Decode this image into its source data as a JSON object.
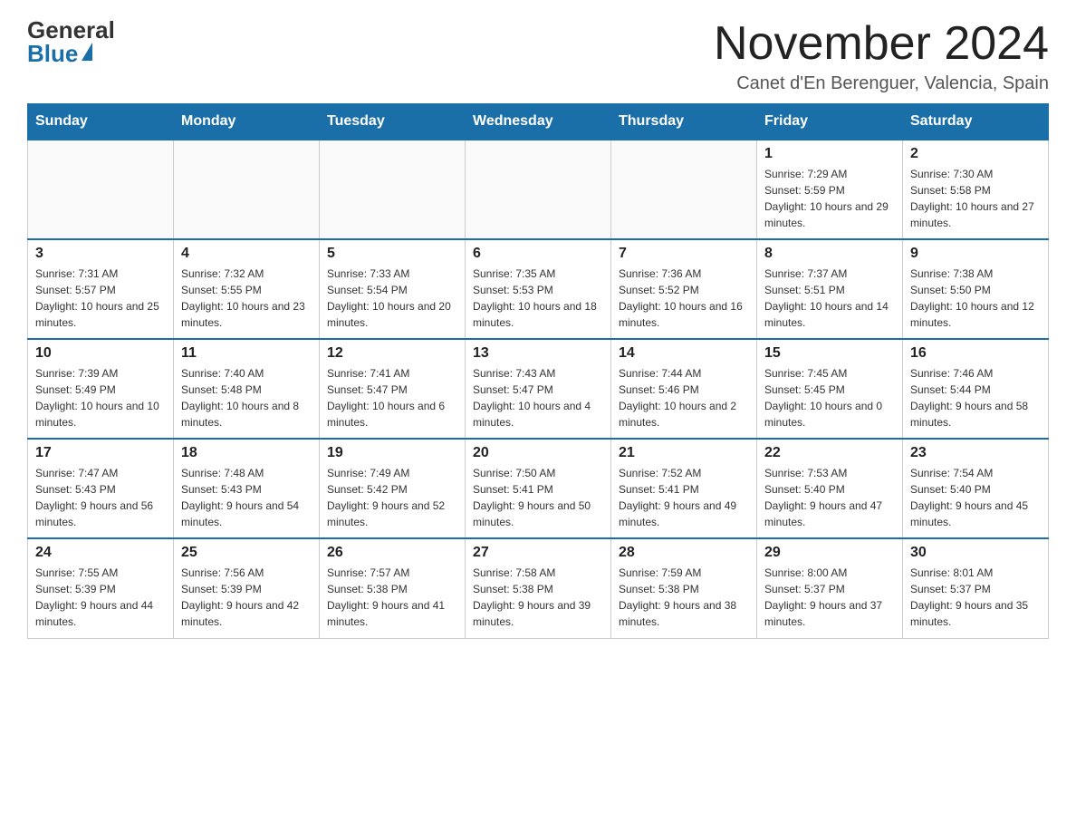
{
  "header": {
    "logo_general": "General",
    "logo_blue": "Blue",
    "month_title": "November 2024",
    "location": "Canet d'En Berenguer, Valencia, Spain"
  },
  "days_of_week": [
    "Sunday",
    "Monday",
    "Tuesday",
    "Wednesday",
    "Thursday",
    "Friday",
    "Saturday"
  ],
  "weeks": [
    [
      {
        "day": "",
        "info": ""
      },
      {
        "day": "",
        "info": ""
      },
      {
        "day": "",
        "info": ""
      },
      {
        "day": "",
        "info": ""
      },
      {
        "day": "",
        "info": ""
      },
      {
        "day": "1",
        "info": "Sunrise: 7:29 AM\nSunset: 5:59 PM\nDaylight: 10 hours and 29 minutes."
      },
      {
        "day": "2",
        "info": "Sunrise: 7:30 AM\nSunset: 5:58 PM\nDaylight: 10 hours and 27 minutes."
      }
    ],
    [
      {
        "day": "3",
        "info": "Sunrise: 7:31 AM\nSunset: 5:57 PM\nDaylight: 10 hours and 25 minutes."
      },
      {
        "day": "4",
        "info": "Sunrise: 7:32 AM\nSunset: 5:55 PM\nDaylight: 10 hours and 23 minutes."
      },
      {
        "day": "5",
        "info": "Sunrise: 7:33 AM\nSunset: 5:54 PM\nDaylight: 10 hours and 20 minutes."
      },
      {
        "day": "6",
        "info": "Sunrise: 7:35 AM\nSunset: 5:53 PM\nDaylight: 10 hours and 18 minutes."
      },
      {
        "day": "7",
        "info": "Sunrise: 7:36 AM\nSunset: 5:52 PM\nDaylight: 10 hours and 16 minutes."
      },
      {
        "day": "8",
        "info": "Sunrise: 7:37 AM\nSunset: 5:51 PM\nDaylight: 10 hours and 14 minutes."
      },
      {
        "day": "9",
        "info": "Sunrise: 7:38 AM\nSunset: 5:50 PM\nDaylight: 10 hours and 12 minutes."
      }
    ],
    [
      {
        "day": "10",
        "info": "Sunrise: 7:39 AM\nSunset: 5:49 PM\nDaylight: 10 hours and 10 minutes."
      },
      {
        "day": "11",
        "info": "Sunrise: 7:40 AM\nSunset: 5:48 PM\nDaylight: 10 hours and 8 minutes."
      },
      {
        "day": "12",
        "info": "Sunrise: 7:41 AM\nSunset: 5:47 PM\nDaylight: 10 hours and 6 minutes."
      },
      {
        "day": "13",
        "info": "Sunrise: 7:43 AM\nSunset: 5:47 PM\nDaylight: 10 hours and 4 minutes."
      },
      {
        "day": "14",
        "info": "Sunrise: 7:44 AM\nSunset: 5:46 PM\nDaylight: 10 hours and 2 minutes."
      },
      {
        "day": "15",
        "info": "Sunrise: 7:45 AM\nSunset: 5:45 PM\nDaylight: 10 hours and 0 minutes."
      },
      {
        "day": "16",
        "info": "Sunrise: 7:46 AM\nSunset: 5:44 PM\nDaylight: 9 hours and 58 minutes."
      }
    ],
    [
      {
        "day": "17",
        "info": "Sunrise: 7:47 AM\nSunset: 5:43 PM\nDaylight: 9 hours and 56 minutes."
      },
      {
        "day": "18",
        "info": "Sunrise: 7:48 AM\nSunset: 5:43 PM\nDaylight: 9 hours and 54 minutes."
      },
      {
        "day": "19",
        "info": "Sunrise: 7:49 AM\nSunset: 5:42 PM\nDaylight: 9 hours and 52 minutes."
      },
      {
        "day": "20",
        "info": "Sunrise: 7:50 AM\nSunset: 5:41 PM\nDaylight: 9 hours and 50 minutes."
      },
      {
        "day": "21",
        "info": "Sunrise: 7:52 AM\nSunset: 5:41 PM\nDaylight: 9 hours and 49 minutes."
      },
      {
        "day": "22",
        "info": "Sunrise: 7:53 AM\nSunset: 5:40 PM\nDaylight: 9 hours and 47 minutes."
      },
      {
        "day": "23",
        "info": "Sunrise: 7:54 AM\nSunset: 5:40 PM\nDaylight: 9 hours and 45 minutes."
      }
    ],
    [
      {
        "day": "24",
        "info": "Sunrise: 7:55 AM\nSunset: 5:39 PM\nDaylight: 9 hours and 44 minutes."
      },
      {
        "day": "25",
        "info": "Sunrise: 7:56 AM\nSunset: 5:39 PM\nDaylight: 9 hours and 42 minutes."
      },
      {
        "day": "26",
        "info": "Sunrise: 7:57 AM\nSunset: 5:38 PM\nDaylight: 9 hours and 41 minutes."
      },
      {
        "day": "27",
        "info": "Sunrise: 7:58 AM\nSunset: 5:38 PM\nDaylight: 9 hours and 39 minutes."
      },
      {
        "day": "28",
        "info": "Sunrise: 7:59 AM\nSunset: 5:38 PM\nDaylight: 9 hours and 38 minutes."
      },
      {
        "day": "29",
        "info": "Sunrise: 8:00 AM\nSunset: 5:37 PM\nDaylight: 9 hours and 37 minutes."
      },
      {
        "day": "30",
        "info": "Sunrise: 8:01 AM\nSunset: 5:37 PM\nDaylight: 9 hours and 35 minutes."
      }
    ]
  ]
}
